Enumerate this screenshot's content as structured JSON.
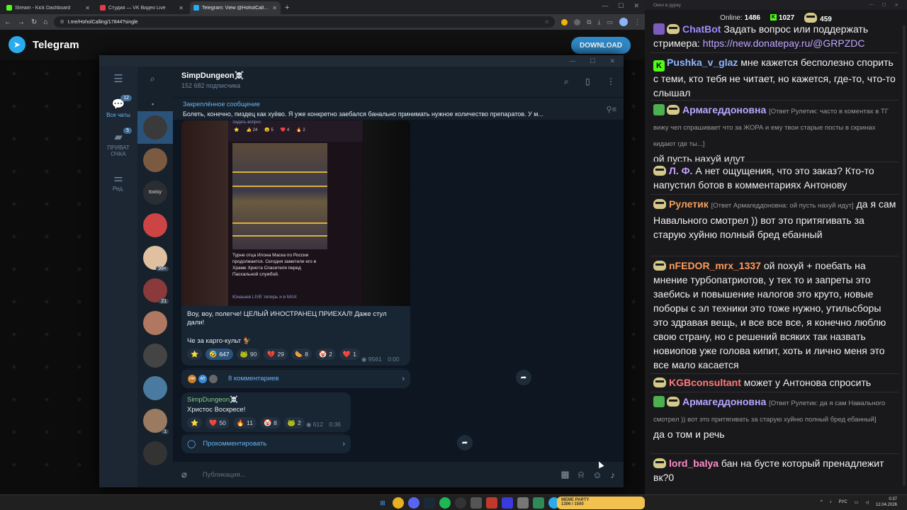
{
  "browser": {
    "tabs": [
      {
        "title": "Stream - Kick Dashboard",
        "color": "#53fc18"
      },
      {
        "title": "Студия — VK Видео Live",
        "color": "#e23b4a"
      },
      {
        "title": "Telegram: View @HoholCalling",
        "color": "#2aabee"
      }
    ],
    "new_tab": "+",
    "url": "t.me/HoholCalling/17844?single"
  },
  "tg_page": {
    "brand": "Telegram",
    "download_label": "DOWNLOAD"
  },
  "tg_app": {
    "menu": [
      {
        "label": "Все чаты",
        "icon": "chat-bubbles-icon",
        "badge": "12"
      },
      {
        "label": "ПРИВАТ ОЧКА",
        "icon": "folder-icon",
        "badge": "5"
      },
      {
        "label": "Ред.",
        "icon": "edit-icon"
      }
    ],
    "chat_avatars": [
      {
        "color": "#3a3a3a",
        "badge": ""
      },
      {
        "color": "#7a5a40",
        "badge": ""
      },
      {
        "color": "#2a2e33",
        "badge": "",
        "text": "toxisy"
      },
      {
        "color": "#c44",
        "badge": ""
      },
      {
        "color": "#e0c0a0",
        "badge": "99+"
      },
      {
        "color": "#8a3a3a",
        "badge": "21"
      },
      {
        "color": "#b07860",
        "badge": ""
      },
      {
        "color": "#444",
        "badge": ""
      },
      {
        "color": "#4a7aa0",
        "badge": ""
      },
      {
        "color": "#9a7a60",
        "badge": "1"
      },
      {
        "color": "#333",
        "badge": ""
      }
    ],
    "channel": {
      "name": "SimpDungeon☠️",
      "subscribers": "152 682 подписчика"
    },
    "pinned": {
      "label": "Закреплённое сообщение",
      "text": "Болеть, конечно, пиздец как хуёво. Я уже конкретно заебался банально принимать нужное количество препаратов. У м..."
    },
    "post1": {
      "phone_header": "Задать вопрос",
      "mini_reactions": [
        "⭐",
        "👍 24",
        "😮 5",
        "❤️ 4",
        "🔥 2"
      ],
      "photo_caption": "Турне отца Илона Маска по России продолжается. Сегодня заметили его в Храме Христа Спасителя перед Пасхальной службой.",
      "photo_link": "Юнашев LIVE теперь и в MAX",
      "text1": "Воу, воу, полегче! ЦЕЛЫЙ ИНОСТРАНЕЦ ПРИЕХАЛ! Даже стул дали!",
      "text2": "Че за карго-культ 🐓",
      "reactions": [
        {
          "emoji": "⭐",
          "count": ""
        },
        {
          "emoji": "🤣",
          "count": "647"
        },
        {
          "emoji": "🐸",
          "count": "90"
        },
        {
          "emoji": "💔",
          "count": "29"
        },
        {
          "emoji": "🌭",
          "count": "8"
        },
        {
          "emoji": "🤡",
          "count": "2"
        },
        {
          "emoji": "❤️",
          "count": "1"
        }
      ],
      "views": "9561",
      "time": "0:00",
      "commenter_initials": [
        "ИМ",
        "АП",
        ""
      ],
      "comments_label": "8 комментариев"
    },
    "post2": {
      "author": "SimpDungeon☠️",
      "text": "Христос Воскресе!",
      "reactions": [
        {
          "emoji": "⭐",
          "count": ""
        },
        {
          "emoji": "❤️",
          "count": "50"
        },
        {
          "emoji": "🔥",
          "count": "11"
        },
        {
          "emoji": "🤡",
          "count": "8"
        },
        {
          "emoji": "🐸",
          "count": "2"
        }
      ],
      "views": "612",
      "time": "0:36",
      "comment_label": "Прокомментировать"
    },
    "composer_placeholder": "Публикация..."
  },
  "chat_panel": {
    "window_title": "Окно в дурку",
    "online_label": "Online:",
    "online_count": "1486",
    "kick_count": "1027",
    "vk_count": "459",
    "messages": [
      {
        "user": "ChatBot",
        "color": "#9d8cff",
        "badge": "#7d5bbe",
        "reply": "",
        "text": "Задать вопрос или поддержать стримера: ",
        "link": "https://new.donatepay.ru/@GRPZDC"
      },
      {
        "user": "Pushka_v_glaz",
        "color": "#8fb3ff",
        "badge": "#53fc18",
        "reply": "",
        "text": "мне кажется бесполезно спорить с теми, кто тебя не читает, но кажется, где-то, что-то слышал",
        "link": ""
      },
      {
        "user": "Армагеддоновна",
        "color": "#b8a6ff",
        "badge": "#4caf50",
        "reply": "[Ответ Рулетик: часто в коментах в ТГ вижу чел спрашивает что за ЖОРА и ему твои старые посты в скринах кидают где ты...]",
        "text": "ой пусть нахуй идут",
        "link": ""
      },
      {
        "user": "Л. Ф.",
        "color": "#c9a0ff",
        "badge": "",
        "reply": "",
        "text": "А нет ощущения, что это заказ? Кто-то напустил ботов в комментариях Антонову",
        "link": ""
      },
      {
        "user": "Рулетик",
        "color": "#f0a060",
        "badge": "",
        "reply": "[Ответ Армагеддоновна: ой пусть нахуй идут]",
        "text": "да я сам Навального смотрел )) вот это притягивать за старую хуйню полный бред ебанный",
        "link": ""
      },
      {
        "user": "nFEDOR_mrx_1337",
        "color": "#ff9a5c",
        "badge": "",
        "reply": "",
        "text": "ой похуй + поебать на мнение турбопатриотов, у тех то и запреты это заебись и повышение налогов это круто, новые поборы с эл техники это тоже нужно, утильсборы это здравая вещь, и все все все, я конечно люблю свою страну, но с решений всяких так назвать новиопов уже голова кипит, хоть и лично меня это все мало касается",
        "link": ""
      },
      {
        "user": "KGBconsultant",
        "color": "#ff7a7a",
        "badge": "",
        "reply": "",
        "text": "может у Антонова спросить",
        "link": ""
      },
      {
        "user": "Армагеддоновна",
        "color": "#b8a6ff",
        "badge": "#4caf50",
        "reply": "[Ответ Рулетик: да я сам Навального смотрел )) вот это притягивать за старую хуйню полный бред ебанный]",
        "text": "да о том и речь",
        "link": ""
      },
      {
        "user": "lord_balya",
        "color": "#ff8cc6",
        "badge": "",
        "reply": "",
        "text": "бан на бусте который пренадлежит вк?0",
        "link": ""
      }
    ]
  },
  "taskbar": {
    "pill_title": "MEME PARTY",
    "pill_progress": "1306 / 1500",
    "lang": "РУС",
    "time": "0:37",
    "date": "12.04.2026"
  }
}
